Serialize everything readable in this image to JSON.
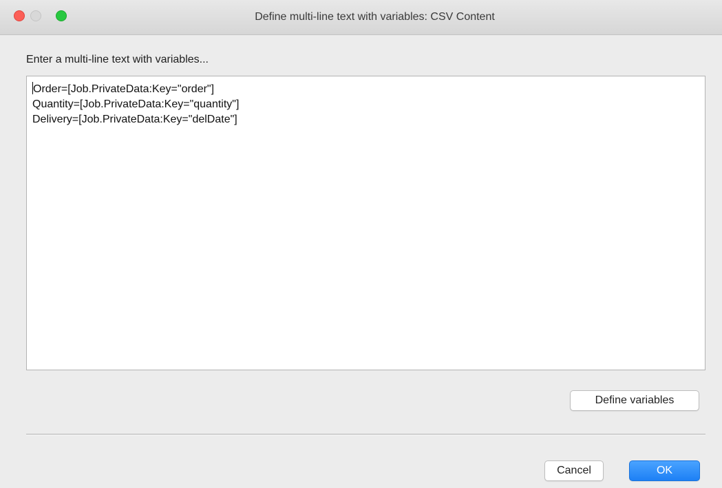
{
  "window": {
    "title": "Define multi-line text with variables: CSV Content"
  },
  "prompt": "Enter a multi-line text with variables...",
  "editor": {
    "lines": [
      "Order=[Job.PrivateData:Key=\"order\"]",
      "Quantity=[Job.PrivateData:Key=\"quantity\"]",
      "Delivery=[Job.PrivateData:Key=\"delDate\"]"
    ]
  },
  "buttons": {
    "define_variables": "Define variables",
    "cancel": "Cancel",
    "ok": "OK"
  },
  "colors": {
    "accent": "#1d80f5",
    "close": "#fc5f57",
    "zoom": "#28c840"
  }
}
